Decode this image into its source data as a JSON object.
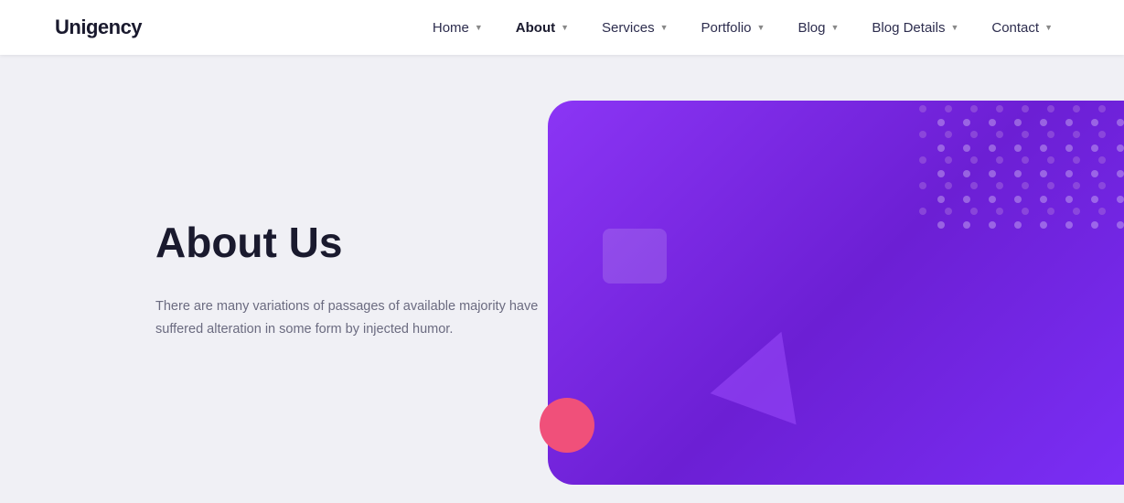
{
  "logo": {
    "uni": "Uni",
    "gency": "gency"
  },
  "nav": {
    "items": [
      {
        "label": "Home",
        "hasDropdown": true,
        "active": false
      },
      {
        "label": "About",
        "hasDropdown": true,
        "active": true
      },
      {
        "label": "Services",
        "hasDropdown": true,
        "active": false
      },
      {
        "label": "Portfolio",
        "hasDropdown": true,
        "active": false
      },
      {
        "label": "Blog",
        "hasDropdown": true,
        "active": false
      },
      {
        "label": "Blog Details",
        "hasDropdown": true,
        "active": false
      },
      {
        "label": "Contact",
        "hasDropdown": true,
        "active": false
      }
    ]
  },
  "hero": {
    "title": "About Us",
    "description": "There are many variations of passages of available majority have suffered alteration in some form by injected humor."
  }
}
